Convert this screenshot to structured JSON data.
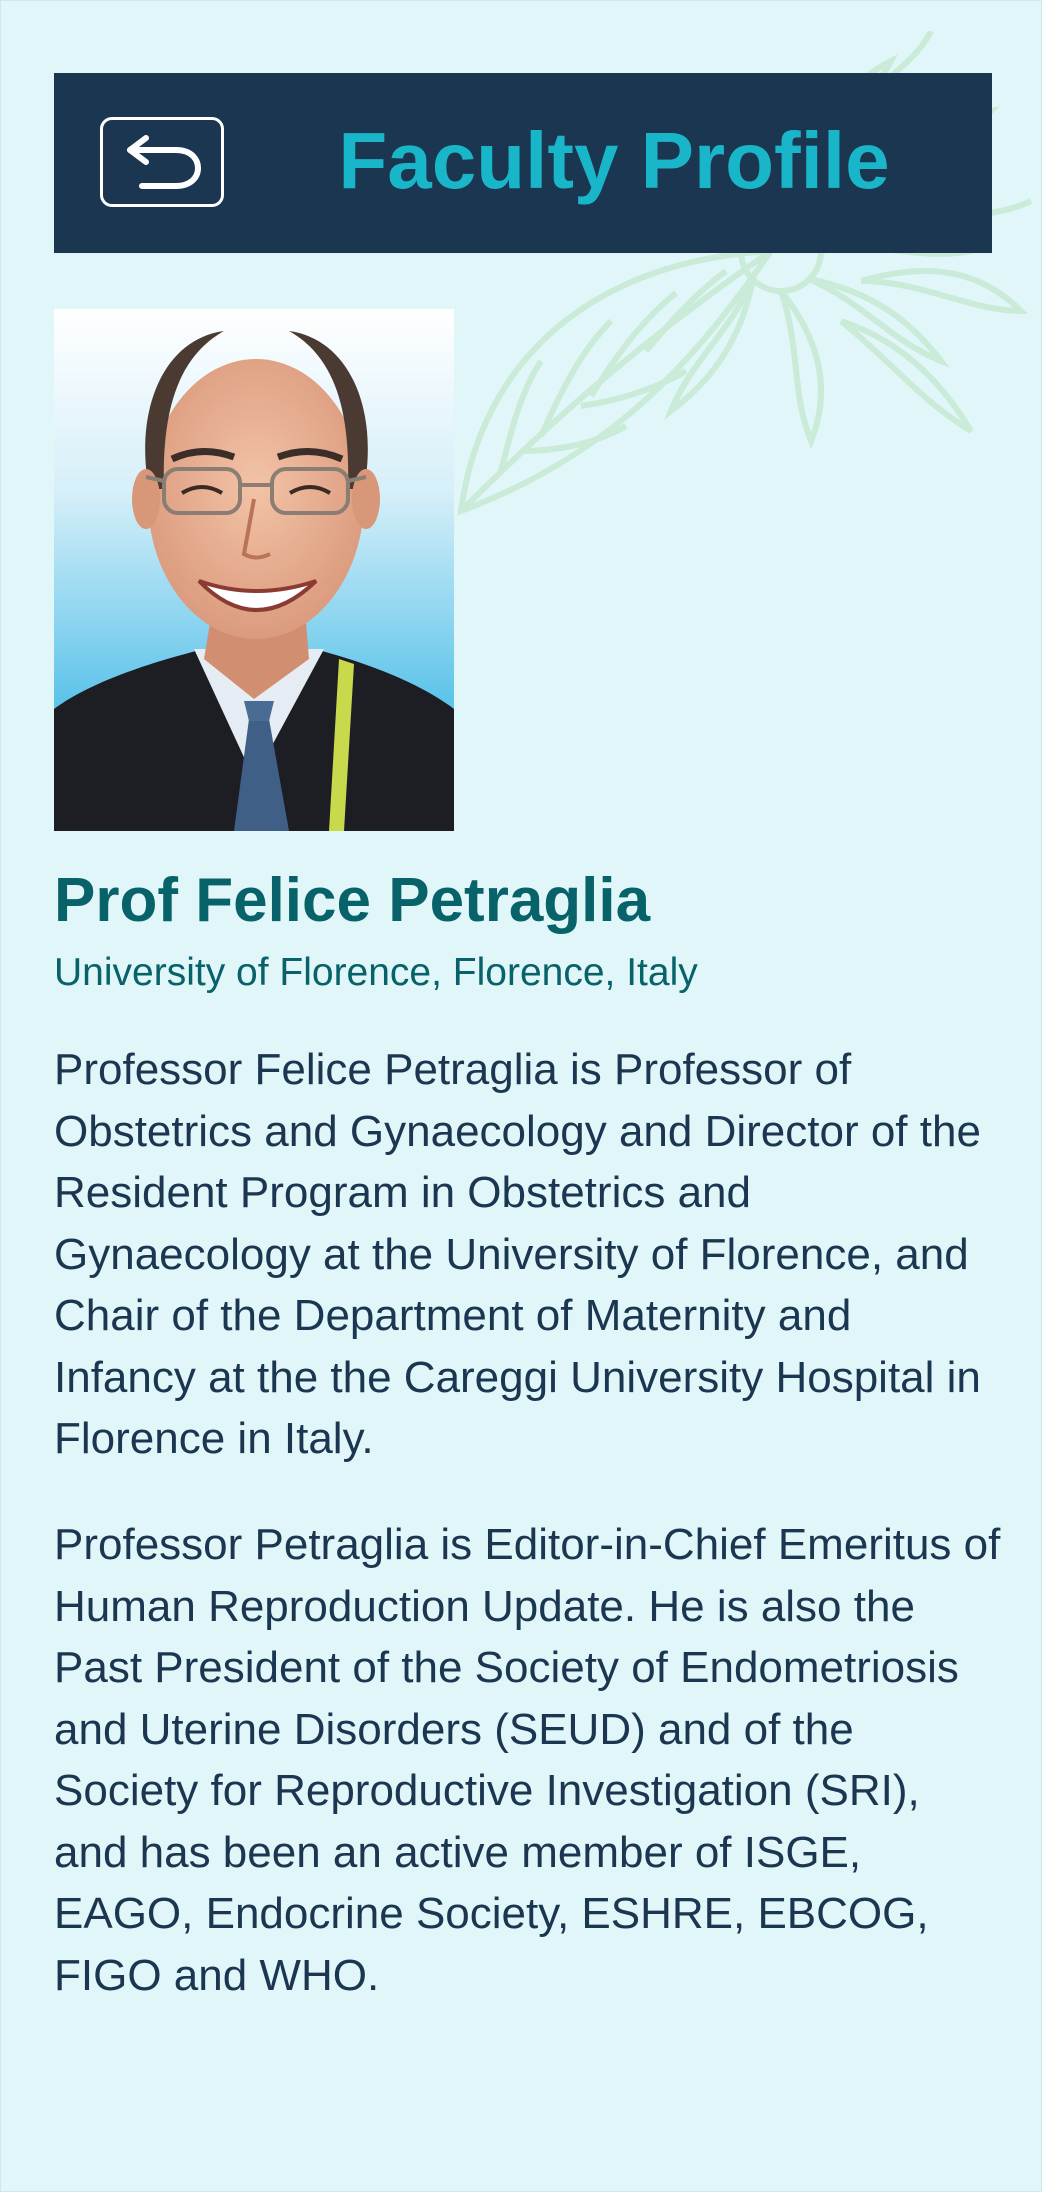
{
  "header": {
    "title": "Faculty Profile",
    "back_icon": "return-arrow-icon"
  },
  "profile": {
    "name": "Prof Felice Petraglia",
    "affiliation": "University of Florence, Florence, Italy",
    "bio": [
      "Professor Felice Petraglia is Professor of Obstetrics and Gynaecology and  Director of the Resident Program in Obstetrics and Gynaecology at the University of Florence, and Chair of the Department of Maternity and Infancy at the the Careggi University Hospital in Florence in Italy.",
      "Professor Petraglia is Editor-in-Chief Emeritus of Human Reproduction Update. He is also the Past President of the Society of Endometriosis and Uterine Disorders (SEUD) and of the Society for Reproductive Investigation (SRI), and has been an active member of ISGE, EAGO, Endocrine Society, ESHRE, EBCOG, FIGO and WHO."
    ]
  },
  "colors": {
    "background": "#e1f6f8",
    "header_bg": "#1b3650",
    "title": "#19b5c8",
    "name": "#08626a",
    "body_text": "#1b3650",
    "decoration": "#c9ebd5"
  }
}
